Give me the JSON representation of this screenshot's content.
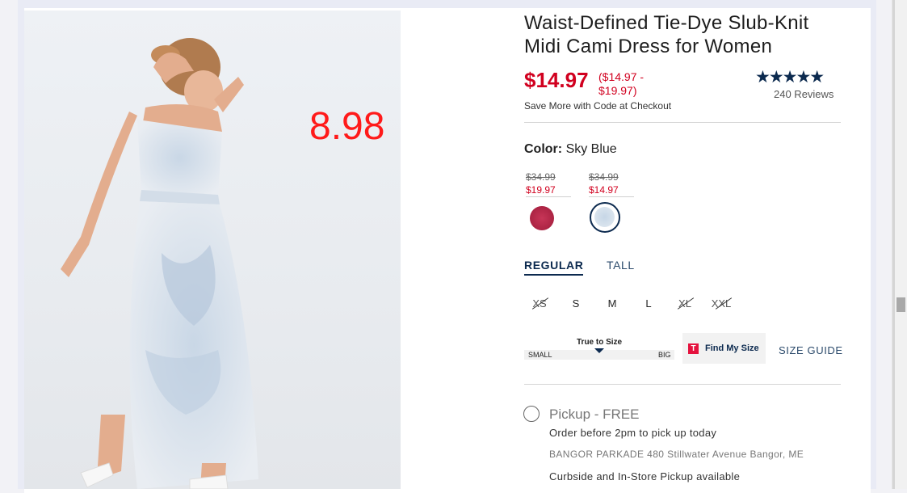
{
  "product": {
    "title": "Waist-Defined Tie-Dye Slub-Knit Midi Cami Dress for Women",
    "price": "$14.97",
    "price_range": "($14.97 - $19.97)",
    "save_note": "Save More with Code at Checkout",
    "rating_stars": "★★★★★",
    "rating_value": 4.5,
    "reviews": "240 Reviews",
    "image_overlay_price": "8.98"
  },
  "color": {
    "label": "Color:",
    "selected": "Sky Blue",
    "swatches": [
      {
        "orig": "$34.99",
        "sale": "$19.97",
        "color": "#b0223f"
      },
      {
        "orig": "$34.99",
        "sale": "$14.97",
        "color": "#d7e3ec"
      }
    ]
  },
  "fit_tabs": {
    "regular": "REGULAR",
    "tall": "TALL"
  },
  "sizes": [
    "XS",
    "S",
    "M",
    "L",
    "XL",
    "XXL"
  ],
  "fit": {
    "label": "True to Size",
    "small": "SMALL",
    "big": "BIG"
  },
  "find_size": {
    "icon": "T",
    "label": "Find My Size"
  },
  "size_guide": "SIZE GUIDE",
  "pickup": {
    "title": "Pickup - FREE",
    "order": "Order before 2pm to pick up today",
    "store": "BANGOR PARKADE 480 Stillwater Avenue Bangor, ME",
    "curbside": "Curbside and In-Store Pickup available"
  },
  "colors": {
    "accent": "#d1001f",
    "navy": "#0c2a4f"
  }
}
